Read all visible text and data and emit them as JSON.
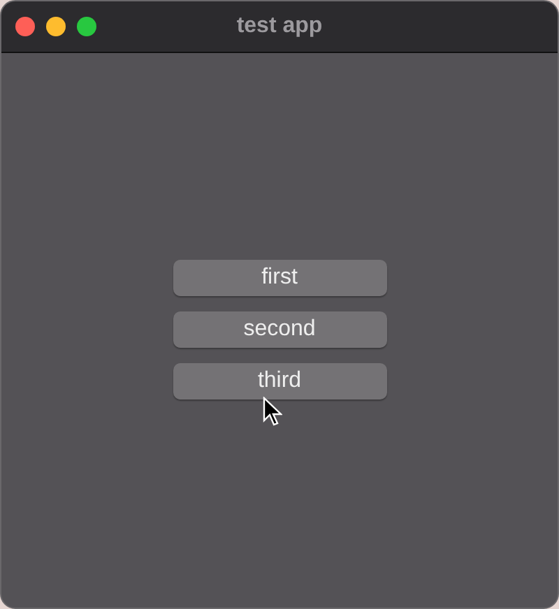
{
  "window": {
    "title": "test app"
  },
  "buttons": [
    {
      "label": "first"
    },
    {
      "label": "second"
    },
    {
      "label": "third"
    }
  ]
}
